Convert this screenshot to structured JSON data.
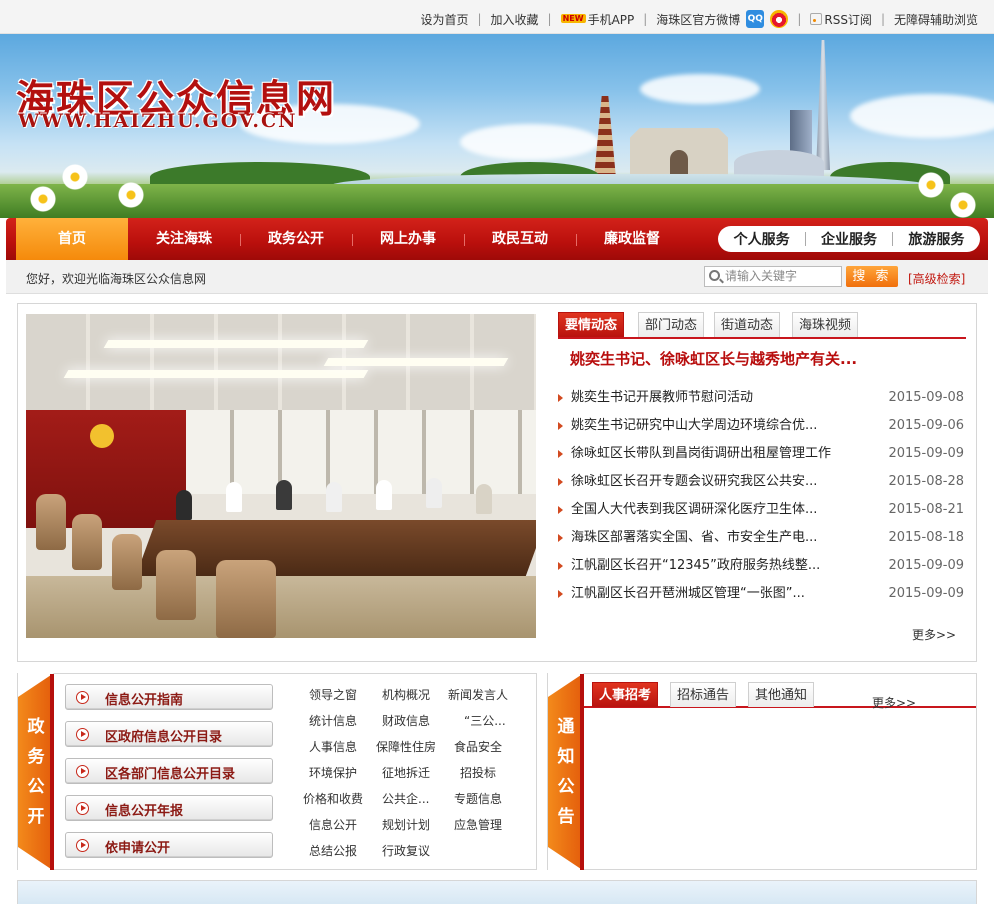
{
  "topbar": {
    "links": [
      "设为首页",
      "加入收藏",
      "手机APP",
      "海珠区官方微博",
      "RSS订阅",
      "无障碍辅助浏览"
    ],
    "new_badge": "NEW",
    "qq_label": "QQ"
  },
  "banner": {
    "title_cn": "海珠区公众信息网",
    "title_en": "WWW.HAIZHU.GOV.CN"
  },
  "nav": {
    "items": [
      "首页",
      "关注海珠",
      "政务公开",
      "网上办事",
      "政民互动",
      "廉政监督"
    ],
    "services": [
      "个人服务",
      "企业服务",
      "旅游服务"
    ]
  },
  "welcome": {
    "text": "您好，欢迎光临海珠区公众信息网",
    "search_placeholder": "请输入关键字",
    "search_button": "搜 索",
    "advanced": "[高级检索]"
  },
  "news": {
    "tabs": [
      "要情动态",
      "部门动态",
      "街道动态",
      "海珠视频"
    ],
    "headline": "姚奕生书记、徐咏虹区长与越秀地产有关...",
    "items": [
      {
        "title": "姚奕生书记开展教师节慰问活动",
        "date": "2015-09-08"
      },
      {
        "title": "姚奕生书记研究中山大学周边环境综合优...",
        "date": "2015-09-06"
      },
      {
        "title": "徐咏虹区长带队到昌岗街调研出租屋管理工作",
        "date": "2015-09-09"
      },
      {
        "title": "徐咏虹区长召开专题会议研究我区公共安...",
        "date": "2015-08-28"
      },
      {
        "title": "全国人大代表到我区调研深化医疗卫生体...",
        "date": "2015-08-21"
      },
      {
        "title": "海珠区部署落实全国、省、市安全生产电...",
        "date": "2015-08-18"
      },
      {
        "title": "江帆副区长召开“12345”政府服务热线整...",
        "date": "2015-09-09"
      },
      {
        "title": "江帆副区长召开琶洲城区管理“一张图”...",
        "date": "2015-09-09"
      }
    ],
    "more": "更多>>"
  },
  "gov_open": {
    "ribbon": [
      "政",
      "务",
      "公",
      "开"
    ],
    "buttons": [
      "信息公开指南",
      "区政府信息公开目录",
      "区各部门信息公开目录",
      "信息公开年报",
      "依申请公开"
    ],
    "categories": [
      [
        "领导之窗",
        "机构概况",
        "新闻发言人"
      ],
      [
        "统计信息",
        "财政信息",
        "“三公..."
      ],
      [
        "人事信息",
        "保障性住房",
        "食品安全"
      ],
      [
        "环境保护",
        "征地拆迁",
        "招投标"
      ],
      [
        "价格和收费",
        "公共企...",
        "专题信息"
      ],
      [
        "信息公开",
        "规划计划",
        "应急管理"
      ],
      [
        "总结公报",
        "行政复议",
        ""
      ]
    ]
  },
  "notice": {
    "ribbon": [
      "通",
      "知",
      "公",
      "告"
    ],
    "tabs": [
      "人事招考",
      "招标通告",
      "其他通知"
    ],
    "more": "更多>>"
  }
}
